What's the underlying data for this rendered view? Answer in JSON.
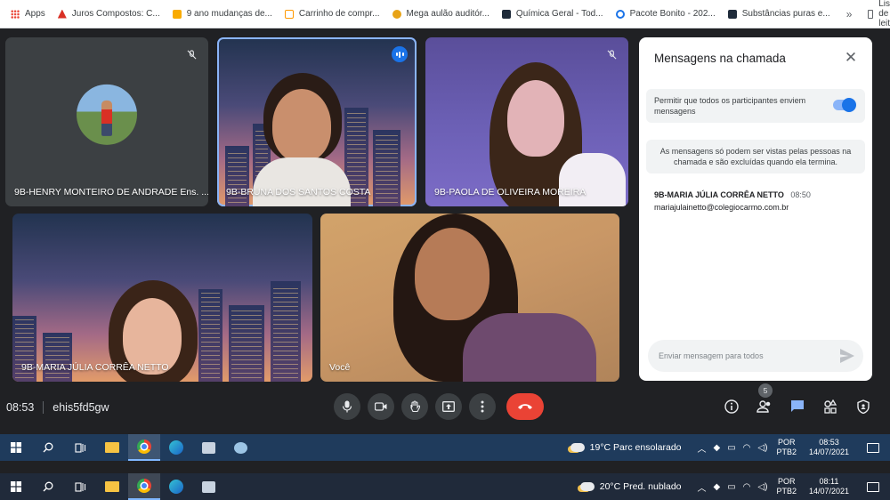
{
  "bookmarks": [
    {
      "label": "Apps",
      "icon": "apps-grid-icon"
    },
    {
      "label": "Juros Compostos: C...",
      "icon": "red-triangle-icon"
    },
    {
      "label": "9 ano mudanças de...",
      "icon": "yellow-bookmark-icon"
    },
    {
      "label": "Carrinho de compr...",
      "icon": "amazon-icon"
    },
    {
      "label": "Mega aulão auditór...",
      "icon": "amber-bookmark-icon"
    },
    {
      "label": "Química Geral - Tod...",
      "icon": "dark-bookmark-icon"
    },
    {
      "label": "Pacote Bonito - 202...",
      "icon": "pacote-icon"
    },
    {
      "label": "Substâncias puras e...",
      "icon": "dark-bookmark-icon"
    }
  ],
  "bookmarks_more": "»",
  "reading_list": "Lista de leitura",
  "participants": [
    {
      "name": "9B-HENRY MONTEIRO DE ANDRADE Ens. ...",
      "muted": true
    },
    {
      "name": "9B-BRUNA DOS SANTOS COSTA",
      "speaking": true
    },
    {
      "name": "9B-PAOLA DE OLIVEIRA MOREIRA",
      "muted": true
    },
    {
      "name": "9B-MARIA JÚLIA CORRÊA NETTO"
    },
    {
      "name": "Você"
    }
  ],
  "chat": {
    "title": "Mensagens na chamada",
    "allow_label": "Permitir que todos os participantes enviem mensagens",
    "allow_enabled": true,
    "info": "As mensagens só podem ser vistas pelas pessoas na chamada e são excluídas quando ela termina.",
    "messages": [
      {
        "sender": "9B-MARIA JÚLIA CORRÊA NETTO",
        "time": "08:50",
        "text": "mariajulainetto@colegiocarmo.com.br"
      }
    ],
    "input_placeholder": "Enviar mensagem para todos"
  },
  "meeting": {
    "time": "08:53",
    "code": "ehis5fd5gw",
    "people_count": "5"
  },
  "taskbar_top": {
    "weather": "19°C  Parc ensolarado",
    "lang_1": "POR",
    "lang_2": "PTB2",
    "time": "08:53",
    "date": "14/07/2021"
  },
  "taskbar_bottom": {
    "weather": "20°C  Pred. nublado",
    "lang_1": "POR",
    "lang_2": "PTB2",
    "time": "08:11",
    "date": "14/07/2021"
  },
  "colors": {
    "accent": "#1a73e8",
    "end_call": "#ea4335",
    "meet_bg": "#202124"
  }
}
